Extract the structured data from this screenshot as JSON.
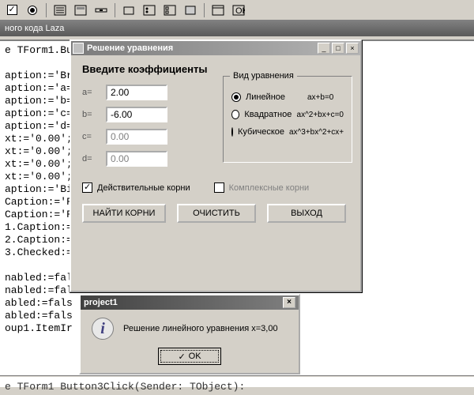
{
  "tab_strip": "ного кода Laza",
  "code_lines": [
    "e TForm1.Bu",
    "",
    "aption:='Br",
    "aption:='a=",
    "aption:='b=",
    "aption:='c=",
    "aption:='d=",
    "xt:='0.00';",
    "xt:='0.00';",
    "xt:='0.00';",
    "xt:='0.00';",
    "aption:='Bi",
    "Caption:='F",
    "Caption:='F",
    "1.Caption:=",
    "2.Caption:=",
    "3.Checked:=",
    "",
    "nabled:=fal",
    "nabled:=fal",
    "abled:=fals",
    "abled:=fals",
    "oup1.ItemIr"
  ],
  "bottom_code": "e TForm1 Button3Click(Sender: TObject):",
  "dialog": {
    "title": "Решение уравнения",
    "heading": "Введите коэффициенты",
    "a_label": "a=",
    "b_label": "b=",
    "c_label": "c=",
    "d_label": "d=",
    "a_value": "2.00",
    "b_value": "-6.00",
    "c_value": "0.00",
    "d_value": "0.00",
    "group_title": "Вид уравнения",
    "radios": [
      {
        "label": "Линейное",
        "formula": "ax+b=0",
        "selected": true
      },
      {
        "label": "Квадратное",
        "formula": "ax^2+bx+c=0",
        "selected": false
      },
      {
        "label": "Кубическое",
        "formula": "ax^3+bx^2+cx+",
        "selected": false
      }
    ],
    "chk_real": "Действительные корни",
    "chk_complex": "Комплексные корни",
    "btn_find": "НАЙТИ КОРНИ",
    "btn_clear": "ОЧИСТИТЬ",
    "btn_exit": "ВЫХОД"
  },
  "msgbox": {
    "title": "project1",
    "text": "Решение линейного уравнения x=3,00",
    "ok": "OK"
  }
}
